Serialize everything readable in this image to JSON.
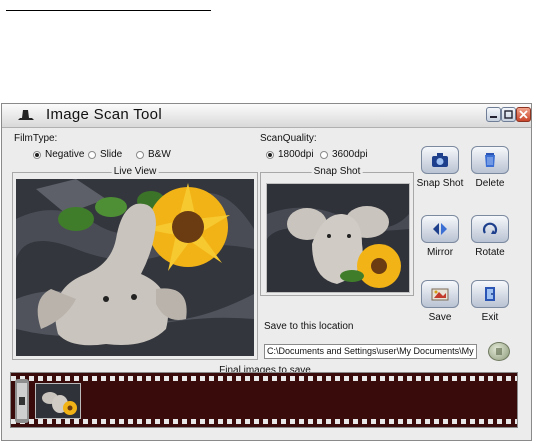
{
  "window": {
    "title": "Image Scan Tool"
  },
  "film_type": {
    "label": "FilmType:",
    "options": [
      {
        "label": "Negative",
        "selected": true
      },
      {
        "label": "Slide",
        "selected": false
      },
      {
        "label": "B&W",
        "selected": false
      }
    ]
  },
  "scan_quality": {
    "label": "ScanQuality:",
    "options": [
      {
        "label": "1800dpi",
        "selected": true
      },
      {
        "label": "3600dpi",
        "selected": false
      }
    ]
  },
  "live_view": {
    "title": "Live View"
  },
  "snap_shot_view": {
    "title": "Snap Shot"
  },
  "buttons": {
    "snap_shot": "Snap Shot",
    "delete": "Delete",
    "mirror": "Mirror",
    "rotate": "Rotate",
    "save": "Save",
    "exit": "Exit"
  },
  "save_location": {
    "label": "Save to this location",
    "path": "C:\\Documents and Settings\\user\\My Documents\\My Pict"
  },
  "final_images": {
    "title": "Final images to save"
  }
}
